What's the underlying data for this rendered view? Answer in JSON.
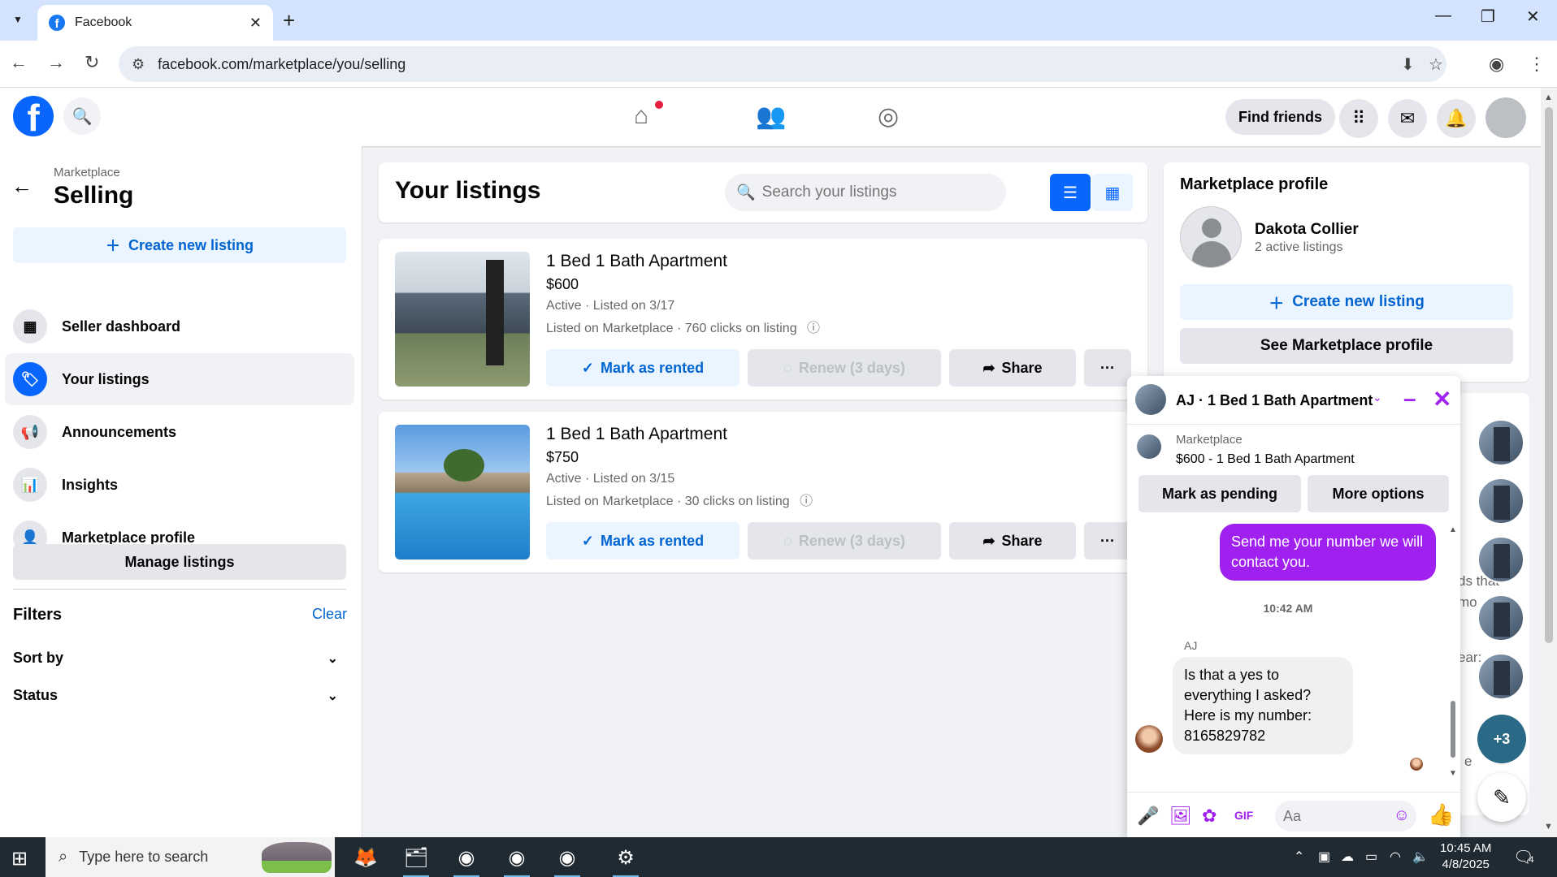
{
  "browser": {
    "tab_title": "Facebook",
    "url": "facebook.com/marketplace/you/selling"
  },
  "header": {
    "find_friends": "Find friends"
  },
  "sidebar": {
    "breadcrumb": "Marketplace",
    "title": "Selling",
    "create_listing": "Create new listing",
    "items": [
      {
        "label": "Seller dashboard",
        "icon": "dashboard-icon"
      },
      {
        "label": "Your listings",
        "icon": "tag-icon"
      },
      {
        "label": "Announcements",
        "icon": "megaphone-icon"
      },
      {
        "label": "Insights",
        "icon": "bar-chart-icon"
      },
      {
        "label": "Marketplace profile",
        "icon": "profile-icon"
      }
    ],
    "manage_listings": "Manage listings",
    "filters_title": "Filters",
    "filters_clear": "Clear",
    "sort_by": "Sort by",
    "status": "Status"
  },
  "main": {
    "title": "Your listings",
    "search_placeholder": "Search your listings",
    "listings": [
      {
        "title": "1 Bed 1 Bath Apartment",
        "price": "$600",
        "status": "Active · Listed on 3/17",
        "clicks": "Listed on Marketplace · 760 clicks on listing",
        "mark_rented": "Mark as rented",
        "renew": "Renew (3 days)",
        "share": "Share",
        "more": "···"
      },
      {
        "title": "1 Bed 1 Bath Apartment",
        "price": "$750",
        "status": "Active · Listed on 3/15",
        "clicks": "Listed on Marketplace · 30 clicks on listing",
        "mark_rented": "Mark as rented",
        "renew": "Renew (3 days)",
        "share": "Share",
        "more": "···"
      }
    ]
  },
  "profile": {
    "title": "Marketplace profile",
    "name": "Dakota Collier",
    "active_listings": "2 active listings",
    "create_listing": "Create new listing",
    "see_profile": "See Marketplace profile"
  },
  "peek": {
    "line1": "ds that",
    "line2": "mo",
    "line3": "ear:",
    "line4": "e"
  },
  "chat": {
    "title": "AJ · 1 Bed 1 Bath Apartment",
    "marketplace_label": "Marketplace",
    "item": "$600 - 1 Bed 1 Bath Apartment",
    "mark_pending": "Mark as pending",
    "more_options": "More options",
    "outgoing": "Send me your number we will contact you.",
    "time": "10:42 AM",
    "sender": "AJ",
    "incoming": "Is that a yes to everything I asked? Here is my number: 8165829782",
    "composer_placeholder": "Aa",
    "accent": "#a020f0"
  },
  "chat_heads": {
    "more_count": "+3"
  },
  "taskbar": {
    "search_placeholder": "Type here to search",
    "time": "10:45 AM",
    "date": "4/8/2025",
    "notif_count": "4"
  }
}
